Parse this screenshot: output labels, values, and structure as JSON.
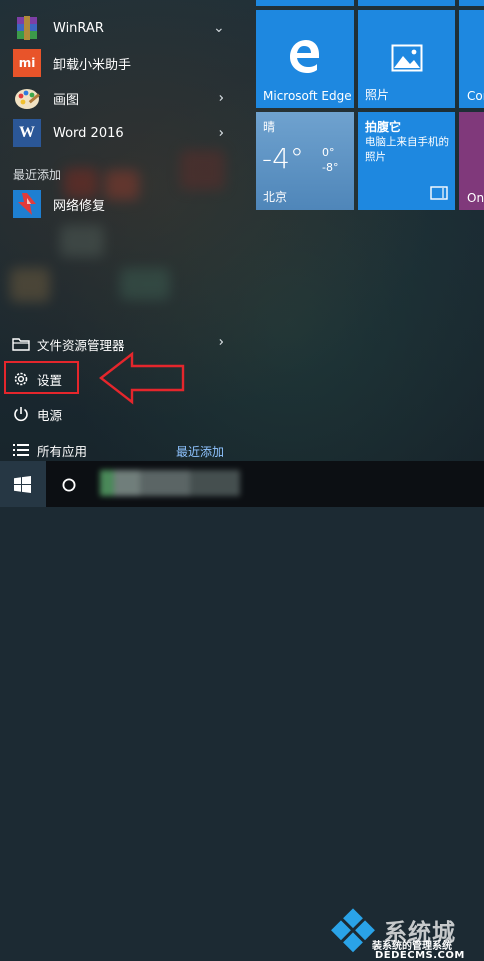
{
  "colors": {
    "accent": "#0078d7",
    "highlight_box": "#e5262c",
    "link": "#8fc3ff"
  },
  "app_list": {
    "items": [
      {
        "label": "WinRAR",
        "icon": "winrar-icon"
      },
      {
        "label": "卸载小米助手",
        "icon": "xiaomi-icon"
      },
      {
        "label": "画图",
        "icon": "paint-icon"
      },
      {
        "label": "Word 2016",
        "icon": "word-icon"
      }
    ],
    "recent_section_label": "最近添加",
    "recent_items": [
      {
        "label": "网络修复",
        "icon": "network-repair-icon"
      }
    ],
    "xiaomi_icon_text": "mi",
    "word_icon_text": "W"
  },
  "system_items": {
    "file_explorer": "文件资源管理器",
    "settings": "设置",
    "power": "电源",
    "all_apps": "所有应用"
  },
  "recently_added_link": "最近添加",
  "tiles": {
    "edge": {
      "label": "Microsoft Edge"
    },
    "photos": {
      "label": "照片"
    },
    "partial_top": {
      "label": "Cor"
    },
    "weather": {
      "condition": "晴",
      "temp": "-4°",
      "high": "0°",
      "low": "-8°",
      "city": "北京"
    },
    "camera_app": {
      "title": "拍腹它",
      "subtitle": "电脑上来自手机的照片"
    },
    "partial_bottom": {
      "label": "One"
    }
  },
  "watermark": {
    "text": "系统城",
    "sub": "装系统的管理系统",
    "url": "DEDECMS.COM"
  }
}
